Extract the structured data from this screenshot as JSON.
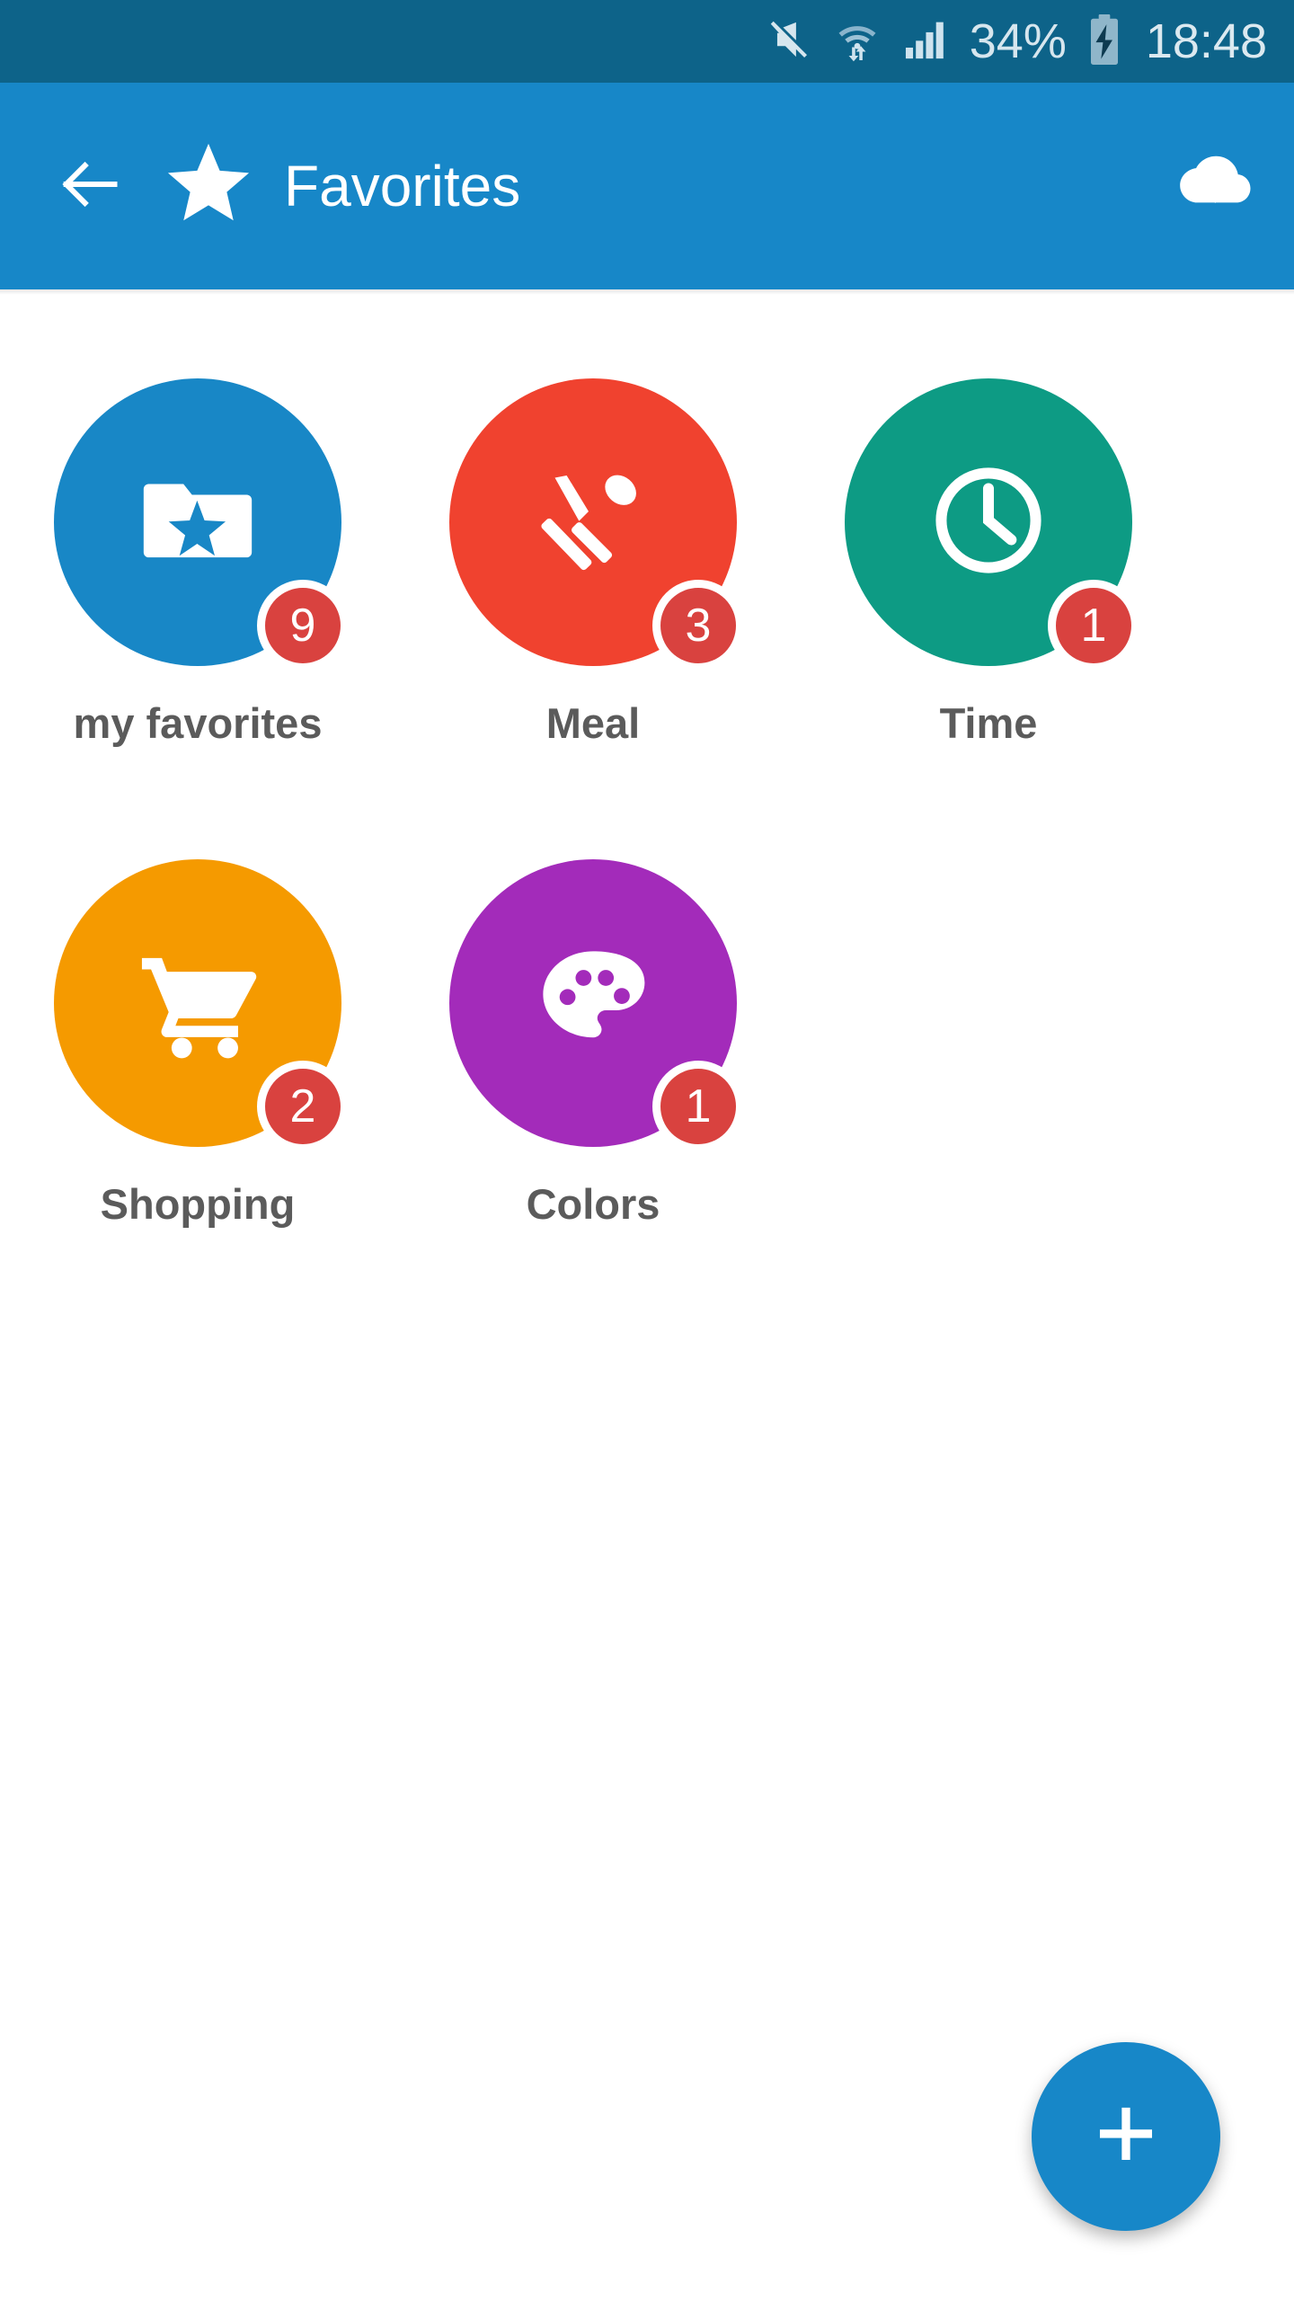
{
  "status_bar": {
    "background": "#0d6389",
    "battery_percent": "34%",
    "clock": "18:48",
    "icons": [
      "mute-icon",
      "wifi-transfer-icon",
      "cellular-signal-icon",
      "battery-charging-icon"
    ]
  },
  "app_bar": {
    "background": "#1787c8",
    "title": "Favorites",
    "back_icon": "back-arrow-icon",
    "star_icon": "star-icon",
    "action_icon": "cloud-download-icon"
  },
  "grid": {
    "items": [
      {
        "label": "my favorites",
        "badge": "9",
        "color": "#1887c6",
        "icon": "folder-star-icon"
      },
      {
        "label": "Meal",
        "badge": "3",
        "color": "#f0422f",
        "icon": "cutlery-icon"
      },
      {
        "label": "Time",
        "badge": "1",
        "color": "#0d9b84",
        "icon": "clock-icon"
      },
      {
        "label": "Shopping",
        "badge": "2",
        "color": "#f59a00",
        "icon": "shopping-cart-icon"
      },
      {
        "label": "Colors",
        "badge": "1",
        "color": "#a32bba",
        "icon": "palette-icon"
      }
    ],
    "badge_color": "#d9423f",
    "label_color": "#5b5b5b"
  },
  "fab": {
    "label": "+",
    "color": "#1787c8",
    "icon": "plus-icon"
  }
}
